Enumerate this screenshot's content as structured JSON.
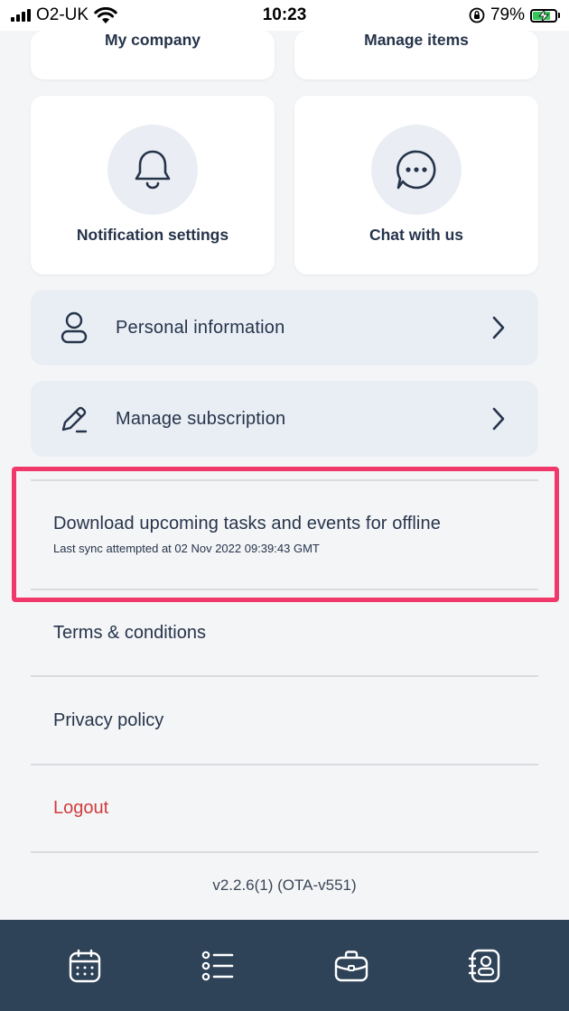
{
  "status_bar": {
    "carrier": "O2-UK",
    "time": "10:23",
    "battery_percent": "79%",
    "icons": [
      "signal-icon",
      "wifi-icon",
      "orientation-lock-icon",
      "battery-charging-icon"
    ]
  },
  "cards": {
    "my_company": "My company",
    "manage_items": "Manage items",
    "notification_settings": "Notification settings",
    "chat_with_us": "Chat with us"
  },
  "menu": {
    "personal_information": "Personal information",
    "manage_subscription": "Manage subscription"
  },
  "offline": {
    "title": "Download upcoming tasks and events for offline",
    "last_sync": "Last sync attempted at 02 Nov 2022 09:39:43 GMT"
  },
  "links": {
    "terms": "Terms & conditions",
    "privacy": "Privacy policy",
    "logout": "Logout"
  },
  "version": "v2.2.6(1) (OTA-v551)",
  "bottom_nav": [
    "calendar-icon",
    "list-icon",
    "briefcase-icon",
    "contacts-icon"
  ],
  "colors": {
    "highlight": "#f0386b",
    "logout": "#d13c3c",
    "nav_background": "#2e4258",
    "menu_row_background": "#e9eef5"
  }
}
